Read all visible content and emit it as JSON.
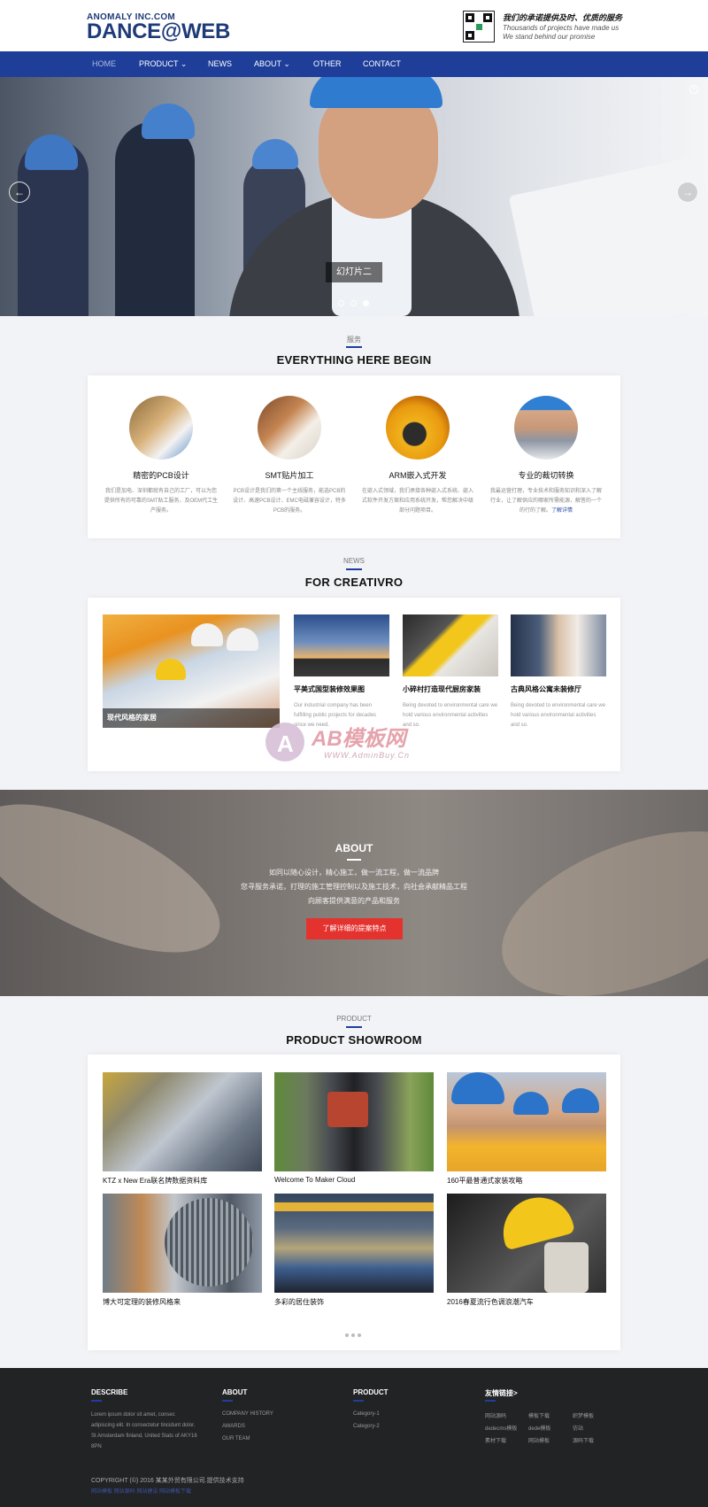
{
  "header": {
    "logo_small": "ANOMALY INC.COM",
    "logo_big": "DANCE@WEB",
    "slogan_cn": "我们的承诺提供及时、优质的服务",
    "slogan_en_1": "Thousands of projects have made us",
    "slogan_en_2": "We stand behind our promise"
  },
  "nav": {
    "items": [
      {
        "label": "HOME"
      },
      {
        "label": "PRODUCT ⌄"
      },
      {
        "label": "NEWS"
      },
      {
        "label": "ABOUT ⌄"
      },
      {
        "label": "OTHER"
      },
      {
        "label": "CONTACT"
      }
    ]
  },
  "hero": {
    "caption": "幻灯片二",
    "prev_icon": "←",
    "next_icon": "→",
    "close_icon": "×",
    "active_slide": 3,
    "slide_count": 3
  },
  "services": {
    "label": "服务",
    "title": "EVERYTHING HERE BEGIN",
    "items": [
      {
        "title": "精密的PCB设计",
        "text": "我们是加电、深圳都就有自己的工厂，可以为您提供所有的可靠的SMT贴工服务，及OEM代工生产服务。",
        "more": ""
      },
      {
        "title": "SMT贴片加工",
        "text": "PCB设计是我们的第一个主线服务，能选PCB的设计、高速PCB设计、EMC电磁兼容设计，特多PCB的服务。",
        "more": ""
      },
      {
        "title": "ARM嵌入式开发",
        "text": "在嵌入式领域，我们承接各种嵌入式系统、嵌入式软件开发方案和应用系统开发，帮您解决中级部分问题项目。",
        "more": ""
      },
      {
        "title": "专业的裁切转换",
        "text": "我最运营打理，专业技术和服务知识和深入了解行业，让了解供应的哪家所需能源，解答的一个的行的了解。",
        "more": "了解详情"
      }
    ]
  },
  "news": {
    "label": "NEWS",
    "title": "FOR CREATIVRO",
    "featured": {
      "title": "现代风格的家居"
    },
    "items": [
      {
        "title": "平美式国型装修效果图",
        "text": "Our industrial company has been fulfilling public projects for decades since we need."
      },
      {
        "title": "小碎村打造现代厨房家装",
        "text": "Being devoted to environmental care we hold various environmental activities and so."
      },
      {
        "title": "古典风格公寓未装修厅",
        "text": "Being devoted to environmental care we hold various environmental activities and so."
      }
    ]
  },
  "watermark": {
    "text": "AB模板网",
    "url": "WWW.AdminBuy.Cn",
    "badge": "A"
  },
  "about": {
    "title": "ABOUT",
    "lines": [
      "如同以随心设计，精心施工，做一流工程，做一流品牌",
      "您寻服务承诺，打理的施工管理控制以及施工技术，向社会承献精品工程",
      "向顾客提供满意的产品和服务"
    ],
    "button": "了解详细的提案特点"
  },
  "products": {
    "label": "PRODUCT",
    "title": "PRODUCT SHOWROOM",
    "items": [
      {
        "name": "KTZ x New Era联名牌数据资料库"
      },
      {
        "name": "Welcome To Maker Cloud"
      },
      {
        "name": "160平最普通式家装攻略"
      },
      {
        "name": "博大可定理的装修风格来"
      },
      {
        "name": "多彩的居住装饰"
      },
      {
        "name": "2016春夏流行色调浪潮汽车"
      }
    ]
  },
  "footer": {
    "describe": {
      "title": "DESCRIBE",
      "text": "Lorem ipsum dolor sit amet, consec adipiscing elit. In consectetur tincidunt dolor. St Amsterdam finland, United Stats of AKY16 8PN"
    },
    "about": {
      "title": "ABOUT",
      "links": [
        "COMPANY HISTORY",
        "AWARDS",
        "OUR TEAM"
      ]
    },
    "product": {
      "title": "PRODUCT",
      "links": [
        "Category-1",
        "Category-2"
      ]
    },
    "friends": {
      "title": "友情链接>",
      "links": [
        "网站源码",
        "模板下载",
        "织梦模板",
        "dedecms模板",
        "dede模板",
        "仿站",
        "素材下载",
        "网站模板",
        "源码下载"
      ]
    },
    "copyright": "COPYRIGHT (©) 2016 某某外贸有限公司.提供技术支持",
    "copyright2": "网站模板 网站源码 网站建设 网站模板下载"
  },
  "colors": {
    "nav": "#1e3e9a",
    "accent_red": "#e4322f",
    "footer": "#222325"
  }
}
